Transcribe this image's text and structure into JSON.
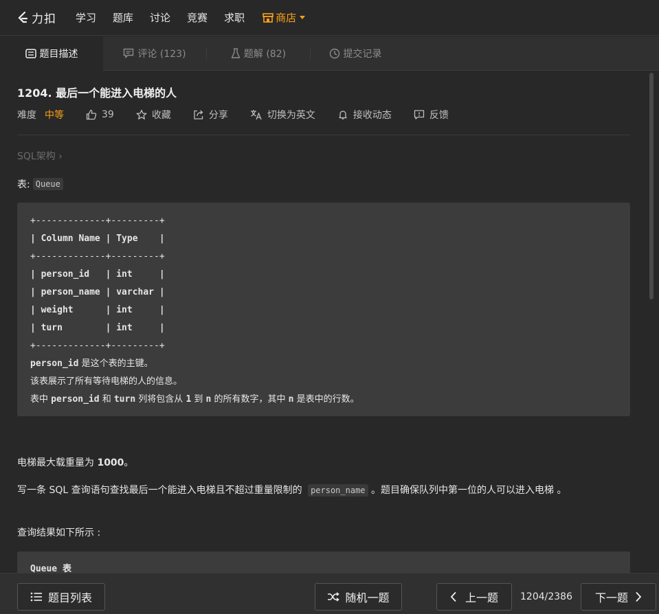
{
  "nav": {
    "brand": "力扣",
    "items": [
      "学习",
      "题库",
      "讨论",
      "竞赛",
      "求职"
    ],
    "shop": "商店"
  },
  "tabs": {
    "description": "题目描述",
    "comments": "评论 (123)",
    "solutions": "题解 (82)",
    "submissions": "提交记录"
  },
  "problem": {
    "title": "1204. 最后一个能进入电梯的人",
    "difficulty_label": "难度",
    "difficulty": "中等",
    "likes": "39",
    "favorite": "收藏",
    "share": "分享",
    "switch_lang": "切换为英文",
    "notifications": "接收动态",
    "feedback": "反馈",
    "breadcrumb": "SQL架构 ›",
    "table_label": "表:",
    "table_name": "Queue"
  },
  "schema": {
    "lines": [
      "+-------------+---------+",
      "| Column Name | Type    |",
      "+-------------+---------+",
      "| person_id   | int     |",
      "| person_name | varchar |",
      "| weight      | int     |",
      "| turn        | int     |",
      "+-------------+---------+"
    ],
    "note1_code": "person_id",
    "note1_text": " 是这个表的主键。",
    "note2": "该表展示了所有等待电梯的人的信息。",
    "note3_a": "表中 ",
    "note3_b": "person_id",
    "note3_c": " 和 ",
    "note3_d": "turn",
    "note3_e": " 列将包含从 ",
    "note3_f": "1",
    "note3_g": " 到 ",
    "note3_h": "n",
    "note3_i": " 的所有数字，其中 ",
    "note3_j": "n",
    "note3_k": " 是表中的行数。"
  },
  "body": {
    "p1_a": "电梯最大载重量为 ",
    "p1_b": "1000",
    "p1_c": "。",
    "p2_a": "写一条 SQL 查询语句查找最后一个能进入电梯且不超过重量限制的 ",
    "p2_code": "person_name",
    "p2_b": " 。题目确保队列中第一位的人可以进入电梯 。",
    "p3": "查询结果如下所示 :",
    "code2": "Queue 表"
  },
  "footer": {
    "list": "题目列表",
    "random": "随机一题",
    "prev": "上一题",
    "pager": "1204/2386",
    "next": "下一题"
  },
  "colors": {
    "accent": "#ffa116",
    "background": "#282828"
  }
}
